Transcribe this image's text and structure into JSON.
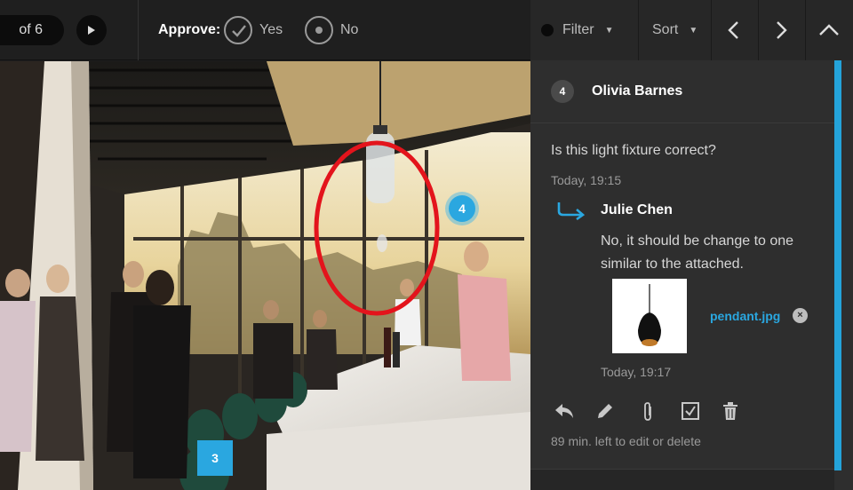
{
  "toolbar": {
    "page_indicator": "of 6",
    "approve_label": "Approve:",
    "approve_yes": "Yes",
    "approve_no": "No",
    "filter_label": "Filter",
    "sort_label": "Sort",
    "icons": {
      "play": "play-icon",
      "check": "check-circle-icon",
      "dot": "radio-dot-icon",
      "filter_bullet": "filter-dot-icon",
      "prev": "chevron-left-icon",
      "next": "chevron-right-icon",
      "collapse": "chevron-up-icon"
    }
  },
  "canvas": {
    "pins": [
      {
        "label": "4"
      },
      {
        "label": "3"
      }
    ],
    "colors": {
      "pin": "#2aa7e0",
      "markup": "#e3141c"
    }
  },
  "thread": {
    "number": "4",
    "author": "Olivia Barnes",
    "comment": "Is this light fixture correct?",
    "time": "Today, 19:15",
    "reply": {
      "author": "Julie Chen",
      "text": "No, it should be change to one similar to the attached.",
      "attachment_name": "pendant.jpg",
      "attachment_remove": "×",
      "time": "Today, 19:17"
    },
    "actions": [
      "reply-icon",
      "pencil-icon",
      "paperclip-icon",
      "checkbox-icon",
      "trash-icon"
    ],
    "edit_notice": "89 min. left to edit or delete"
  },
  "colors": {
    "accent": "#2aa7e0",
    "panel": "#2e2e2e",
    "toolbar": "#1f1f1f"
  }
}
